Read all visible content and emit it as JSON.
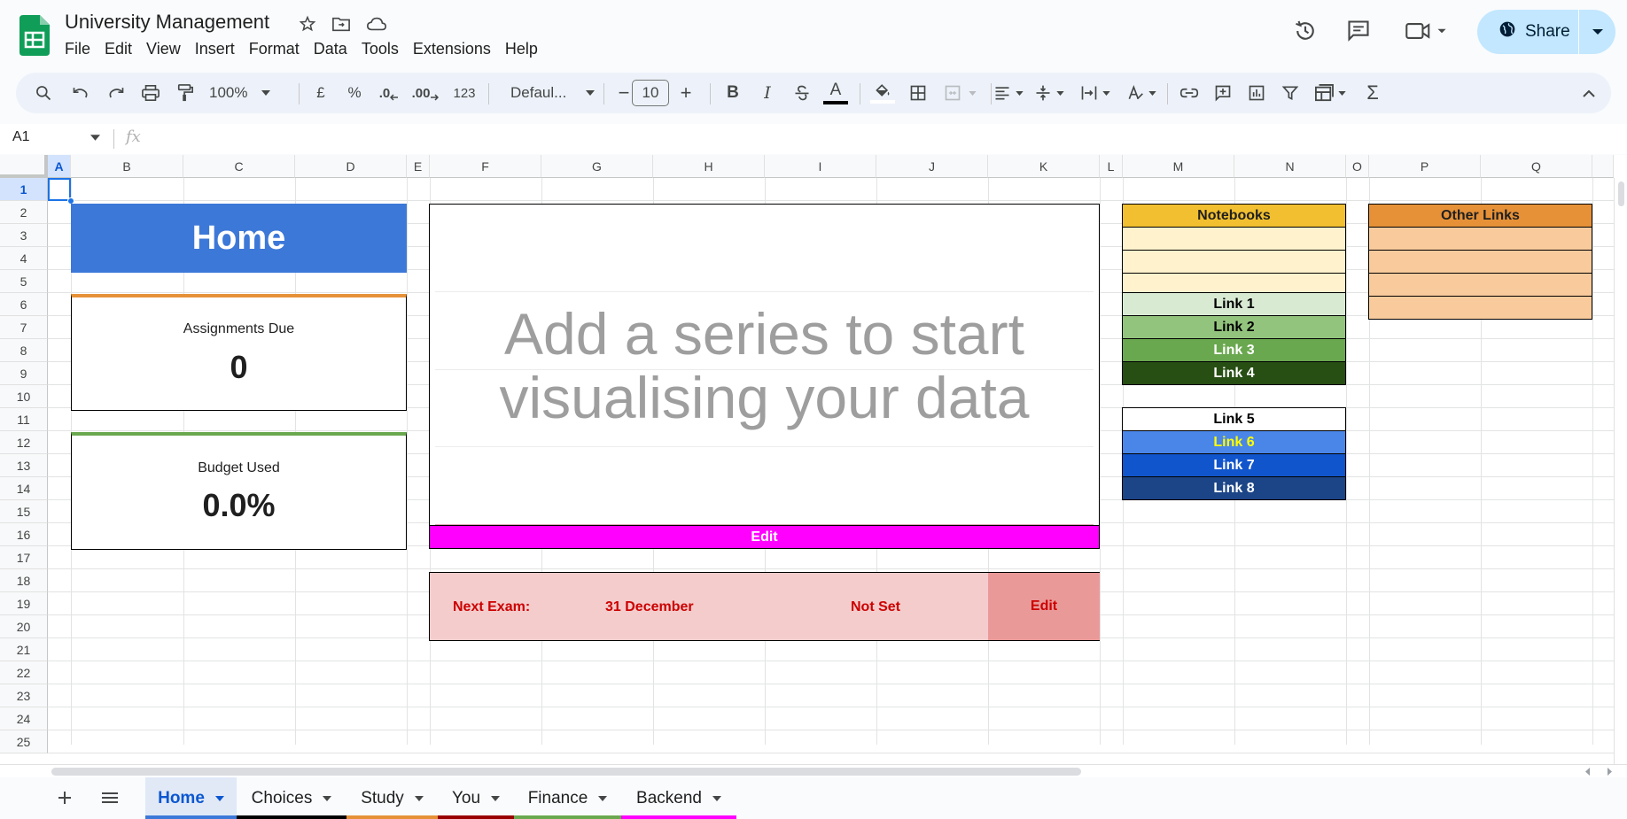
{
  "app": {
    "title": "University Management",
    "menu": [
      "File",
      "Edit",
      "View",
      "Insert",
      "Format",
      "Data",
      "Tools",
      "Extensions",
      "Help"
    ],
    "share_label": "Share"
  },
  "toolbar": {
    "zoom": "100%",
    "currency": "£",
    "percent": "%",
    "dec_decrease": ".0",
    "dec_increase": ".00",
    "number_format": "123",
    "font": "Defaul...",
    "font_size": "10",
    "minus": "−",
    "plus": "+",
    "bold": "B",
    "italic": "I",
    "text_color": "A",
    "sigma": "Σ"
  },
  "formula_bar": {
    "cell_ref": "A1",
    "fx": "fx",
    "content": ""
  },
  "grid": {
    "columns": [
      "A",
      "B",
      "C",
      "D",
      "E",
      "F",
      "G",
      "H",
      "I",
      "J",
      "K",
      "L",
      "M",
      "N",
      "O",
      "P",
      "Q"
    ],
    "rows": [
      "1",
      "2",
      "3",
      "4",
      "5",
      "6",
      "7",
      "8",
      "9",
      "10",
      "11",
      "12",
      "13",
      "14",
      "15",
      "16",
      "17",
      "18",
      "19",
      "20",
      "21",
      "22",
      "23",
      "24",
      "25"
    ]
  },
  "home": {
    "title": "Home",
    "assignments_label": "Assignments Due",
    "assignments_value": "0",
    "budget_label": "Budget Used",
    "budget_value": "0.0%"
  },
  "chart": {
    "placeholder": "Add a series to start visualising your data",
    "edit_label": "Edit"
  },
  "exam": {
    "label": "Next Exam:",
    "date": "31 December",
    "status": "Not Set",
    "edit_label": "Edit"
  },
  "notebooks": {
    "header": "Notebooks",
    "header_color": "#f1bf2f",
    "cell_color": "#fff2cc"
  },
  "other_links": {
    "header": "Other Links",
    "header_color": "#e69138",
    "cell_color": "#f9cb9c"
  },
  "links": [
    {
      "label": "Link 1",
      "bg": "#d9ead3",
      "fg": "#000000"
    },
    {
      "label": "Link 2",
      "bg": "#93c47d",
      "fg": "#000000"
    },
    {
      "label": "Link 3",
      "bg": "#6aa84f",
      "fg": "#ffffff"
    },
    {
      "label": "Link 4",
      "bg": "#274e13",
      "fg": "#ffffff"
    },
    {
      "label": "Link 5",
      "bg": "#ffffff",
      "fg": "#000000"
    },
    {
      "label": "Link 6",
      "bg": "#4a86e8",
      "fg": "#ffff00"
    },
    {
      "label": "Link 7",
      "bg": "#1155cc",
      "fg": "#ffffff"
    },
    {
      "label": "Link 8",
      "bg": "#1c4587",
      "fg": "#ffffff"
    }
  ],
  "sheets": [
    {
      "label": "Home",
      "color": "#3c78d8",
      "active": true
    },
    {
      "label": "Choices",
      "color": "#000000",
      "active": false
    },
    {
      "label": "Study",
      "color": "#e69138",
      "active": false
    },
    {
      "label": "You",
      "color": "#990000",
      "active": false
    },
    {
      "label": "Finance",
      "color": "#6aa84f",
      "active": false
    },
    {
      "label": "Backend",
      "color": "#ff00ff",
      "active": false
    }
  ],
  "colors": {
    "home_blue": "#3c78d8",
    "accent_magenta": "#ff00ff",
    "exam_bg": "#f4cccc",
    "exam_edit_bg": "#ea9999",
    "exam_text": "#cc0000",
    "orange_bar": "#e69138",
    "green_bar": "#6aa84f"
  }
}
